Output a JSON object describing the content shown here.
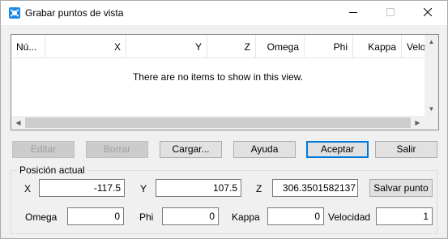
{
  "window": {
    "title": "Grabar puntos de vista",
    "colors": {
      "accent": "#0078d7"
    }
  },
  "icons": {
    "app": "app-icon",
    "minimize": "minimize-icon",
    "maximize": "maximize-icon",
    "close": "close-icon"
  },
  "list": {
    "columns": [
      "Nú...",
      "X",
      "Y",
      "Z",
      "Omega",
      "Phi",
      "Kappa",
      "Veloci"
    ],
    "empty_message": "There are no items to show in this view."
  },
  "buttons": {
    "editar": "Editar",
    "borrar": "Borrar",
    "cargar": "Cargar...",
    "ayuda": "Ayuda",
    "aceptar": "Aceptar",
    "salir": "Salir",
    "salvar_punto": "Salvar punto"
  },
  "position": {
    "group_label": "Posición actual",
    "x_label": "X",
    "x_value": "-117.5",
    "y_label": "Y",
    "y_value": "107.5",
    "z_label": "Z",
    "z_value": "306.3501582137",
    "omega_label": "Omega",
    "omega_value": "0",
    "phi_label": "Phi",
    "phi_value": "0",
    "kappa_label": "Kappa",
    "kappa_value": "0",
    "velocidad_label": "Velocidad",
    "velocidad_value": "1"
  }
}
